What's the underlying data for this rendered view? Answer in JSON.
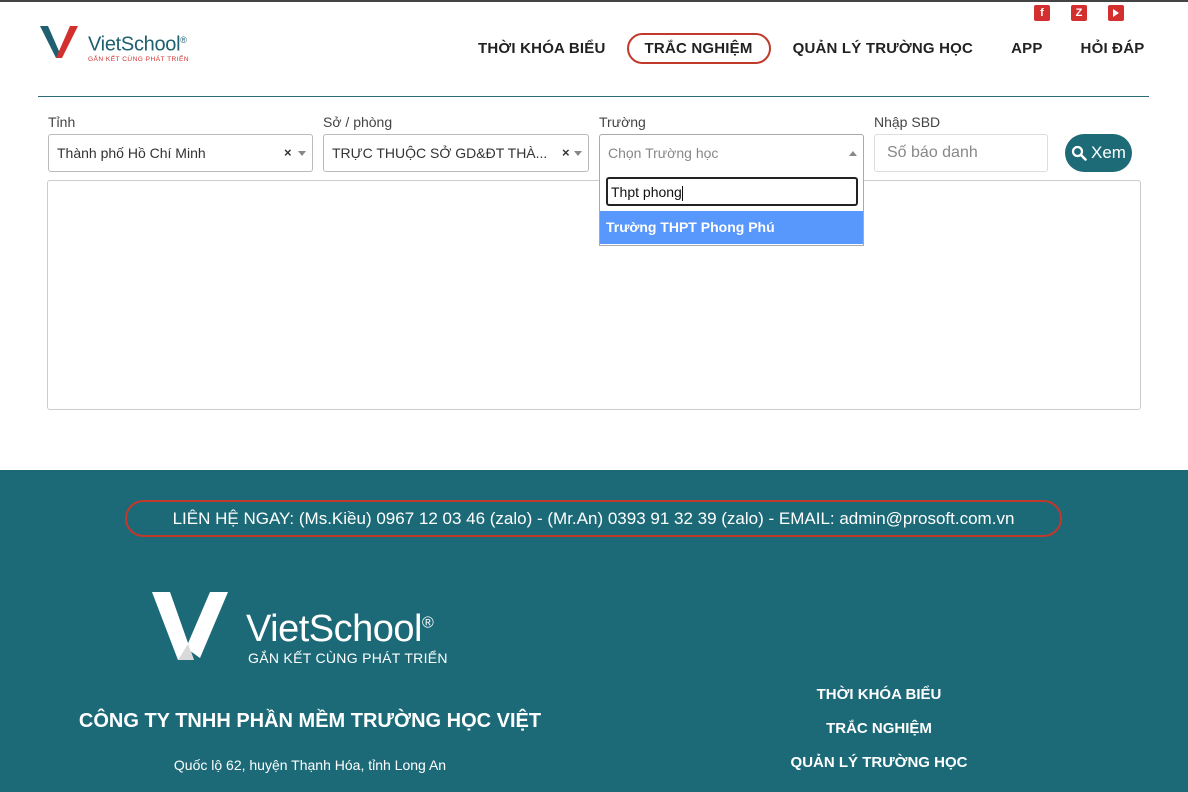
{
  "colors": {
    "teal": "#1c6a78",
    "red": "#c0392b",
    "highlight": "#5897fb"
  },
  "social": {
    "icons": [
      "facebook-icon",
      "zalo-icon",
      "youtube-icon"
    ],
    "zalo_letter": "Z",
    "facebook_letter": "f"
  },
  "header": {
    "brand_name": "VietSchool",
    "brand_registered": "®",
    "brand_tagline": "GẮN KẾT CÙNG PHÁT TRIỂN",
    "nav": {
      "item1": "THỜI KHÓA BIỂU",
      "item2": "TRẮC NGHIỆM",
      "item3": "QUẢN LÝ TRƯỜNG HỌC",
      "item4": "APP",
      "item5": "HỎI ĐÁP"
    }
  },
  "filters": {
    "tinh": {
      "label": "Tỉnh",
      "value": "Thành phố Hồ Chí Minh",
      "clear": "×"
    },
    "so_phong": {
      "label": "Sở / phòng",
      "value": "TRỰC THUỘC SỞ GD&ĐT THÀ...",
      "clear": "×"
    },
    "truong": {
      "label": "Trường",
      "placeholder": "Chọn Trường học"
    },
    "sbd": {
      "label": "Nhập SBD",
      "placeholder": "Số báo danh"
    },
    "xem_button": "Xem"
  },
  "dropdown": {
    "search_value": "Thpt phong",
    "option": "Trường THPT Phong Phú"
  },
  "footer": {
    "contact": "LIÊN HỆ NGAY: (Ms.Kiều) 0967 12 03 46 (zalo) - (Mr.An) 0393 91 32 39 (zalo) - EMAIL: admin@prosoft.com.vn",
    "brand_name": "VietSchool",
    "brand_registered": "®",
    "brand_tagline": "GẮN KẾT CÙNG PHÁT TRIỂN",
    "company": "CÔNG TY TNHH PHẦN MỀM TRƯỜNG HỌC VIỆT",
    "address": "Quốc lộ 62, huyện Thạnh Hóa, tỉnh Long An",
    "links": {
      "link1": "THỜI KHÓA BIỂU",
      "link2": "TRẮC NGHIỆM",
      "link3": "QUẢN LÝ TRƯỜNG HỌC"
    }
  }
}
